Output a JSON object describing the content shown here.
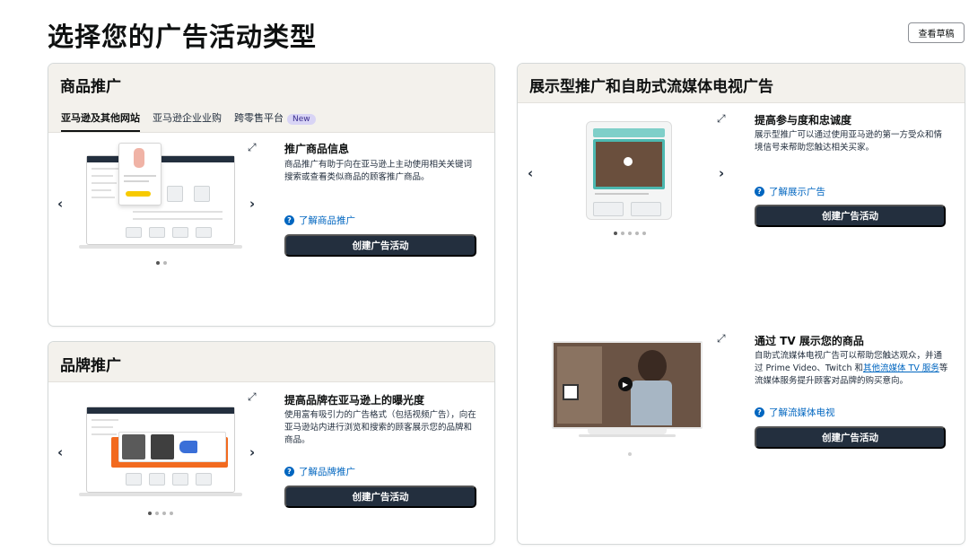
{
  "page": {
    "title": "选择您的广告活动类型",
    "draft_button": "查看草稿"
  },
  "sponsored_products": {
    "title": "商品推广",
    "tabs": [
      {
        "label": "亚马逊及其他网站",
        "active": true
      },
      {
        "label": "亚马逊企业业购",
        "active": false
      },
      {
        "label": "跨零售平台",
        "active": false,
        "badge": "New"
      }
    ],
    "feature_title": "推广商品信息",
    "feature_desc": "商品推广有助于向在亚马逊上主动使用相关关键词搜索或查看类似商品的顾客推广商品。",
    "learn_link": "了解商品推广",
    "cta": "创建广告活动",
    "carousel": {
      "count": 2,
      "active": 0
    }
  },
  "sponsored_brands": {
    "title": "品牌推广",
    "feature_title": "提高品牌在亚马逊上的曝光度",
    "feature_desc": "使用富有吸引力的广告格式（包括视频广告），向在亚马逊站内进行浏览和搜索的顾客展示您的品牌和商品。",
    "learn_link": "了解品牌推广",
    "cta": "创建广告活动",
    "carousel": {
      "count": 4,
      "active": 0
    }
  },
  "display_streaming": {
    "title": "展示型推广和自助式流媒体电视广告",
    "display": {
      "feature_title": "提高参与度和忠诚度",
      "feature_desc": "展示型推广可以通过使用亚马逊的第一方受众和情境信号来帮助您触达相关买家。",
      "learn_link": "了解展示广告",
      "cta": "创建广告活动",
      "carousel": {
        "count": 5,
        "active": 0
      }
    },
    "streaming": {
      "feature_title": "通过 TV 展示您的商品",
      "feature_desc_before": "自助式流媒体电视广告可以帮助您触达观众，并通过 Prime Video、Twitch 和",
      "feature_desc_link": "其他流媒体 TV 服务",
      "feature_desc_after": "等流媒体服务提升顾客对品牌的购买意向。",
      "learn_link": "了解流媒体电视",
      "cta": "创建广告活动",
      "carousel": {
        "count": 1,
        "active": 0
      }
    }
  },
  "icons": {
    "prev": "chevron-left-icon",
    "next": "chevron-right-icon",
    "expand": "expand-icon",
    "help": "question-circle-icon"
  },
  "colors": {
    "cta_bg": "#232f3e",
    "link": "#0066c0",
    "header_bg": "#f3f1ec",
    "badge_bg": "#d8d4f5"
  }
}
